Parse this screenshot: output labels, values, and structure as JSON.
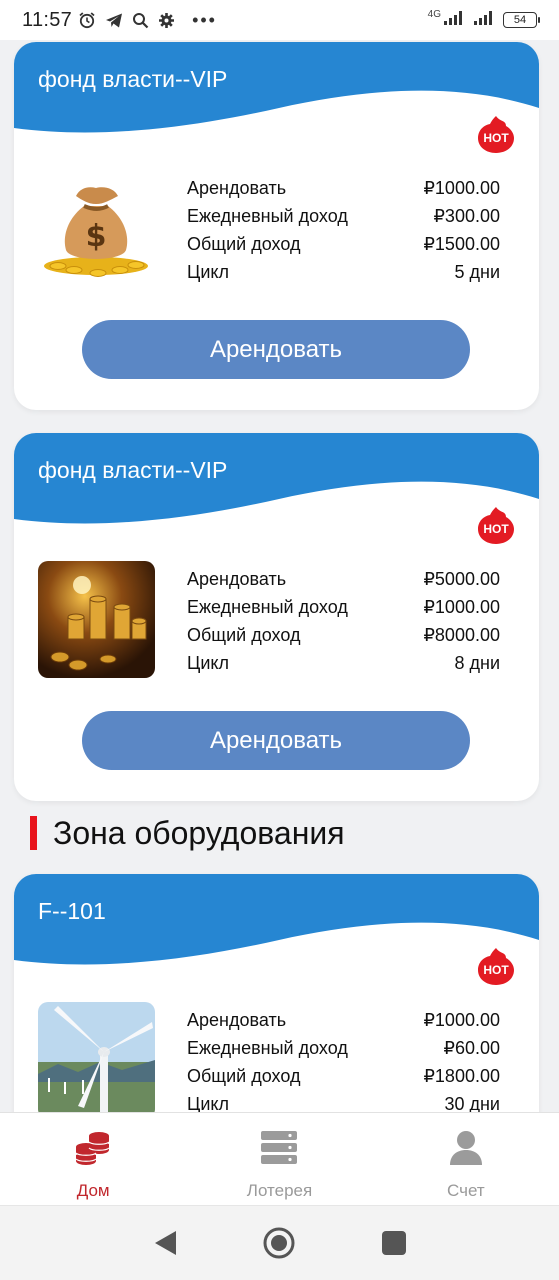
{
  "status_bar": {
    "time": "11:57",
    "network": "4G",
    "battery": "54"
  },
  "products": [
    {
      "title": "фонд власти--VIP",
      "badge": "HOT",
      "image_icon": "money-bag-image",
      "rows": [
        {
          "label": "Арендовать",
          "value": "₽1000.00"
        },
        {
          "label": "Ежедневный доход",
          "value": "₽300.00"
        },
        {
          "label": "Общий доход",
          "value": "₽1500.00"
        },
        {
          "label": "Цикл",
          "value": "5 дни"
        }
      ],
      "button_label": "Арендовать"
    },
    {
      "title": "фонд власти--VIP",
      "badge": "HOT",
      "image_icon": "coin-stacks-image",
      "rows": [
        {
          "label": "Арендовать",
          "value": "₽5000.00"
        },
        {
          "label": "Ежедневный доход",
          "value": "₽1000.00"
        },
        {
          "label": "Общий доход",
          "value": "₽8000.00"
        },
        {
          "label": "Цикл",
          "value": "8 дни"
        }
      ],
      "button_label": "Арендовать"
    }
  ],
  "equipment_section": {
    "title": "Зона оборудования",
    "products": [
      {
        "title": "F--101",
        "badge": "HOT",
        "image_icon": "wind-turbine-image",
        "rows": [
          {
            "label": "Арендовать",
            "value": "₽1000.00"
          },
          {
            "label": "Ежедневный доход",
            "value": "₽60.00"
          },
          {
            "label": "Общий доход",
            "value": "₽1800.00"
          },
          {
            "label": "Цикл",
            "value": "30 дни"
          }
        ]
      }
    ]
  },
  "bottom_nav": {
    "items": [
      {
        "label": "Дом",
        "icon": "coins-stack-icon",
        "active": true
      },
      {
        "label": "Лотерея",
        "icon": "server-stack-icon",
        "active": false
      },
      {
        "label": "Счет",
        "icon": "user-icon",
        "active": false
      }
    ]
  },
  "colors": {
    "card_header": "#2686d2",
    "button": "#5b87c5",
    "accent_red": "#e8141c",
    "nav_active": "#c1272d"
  }
}
